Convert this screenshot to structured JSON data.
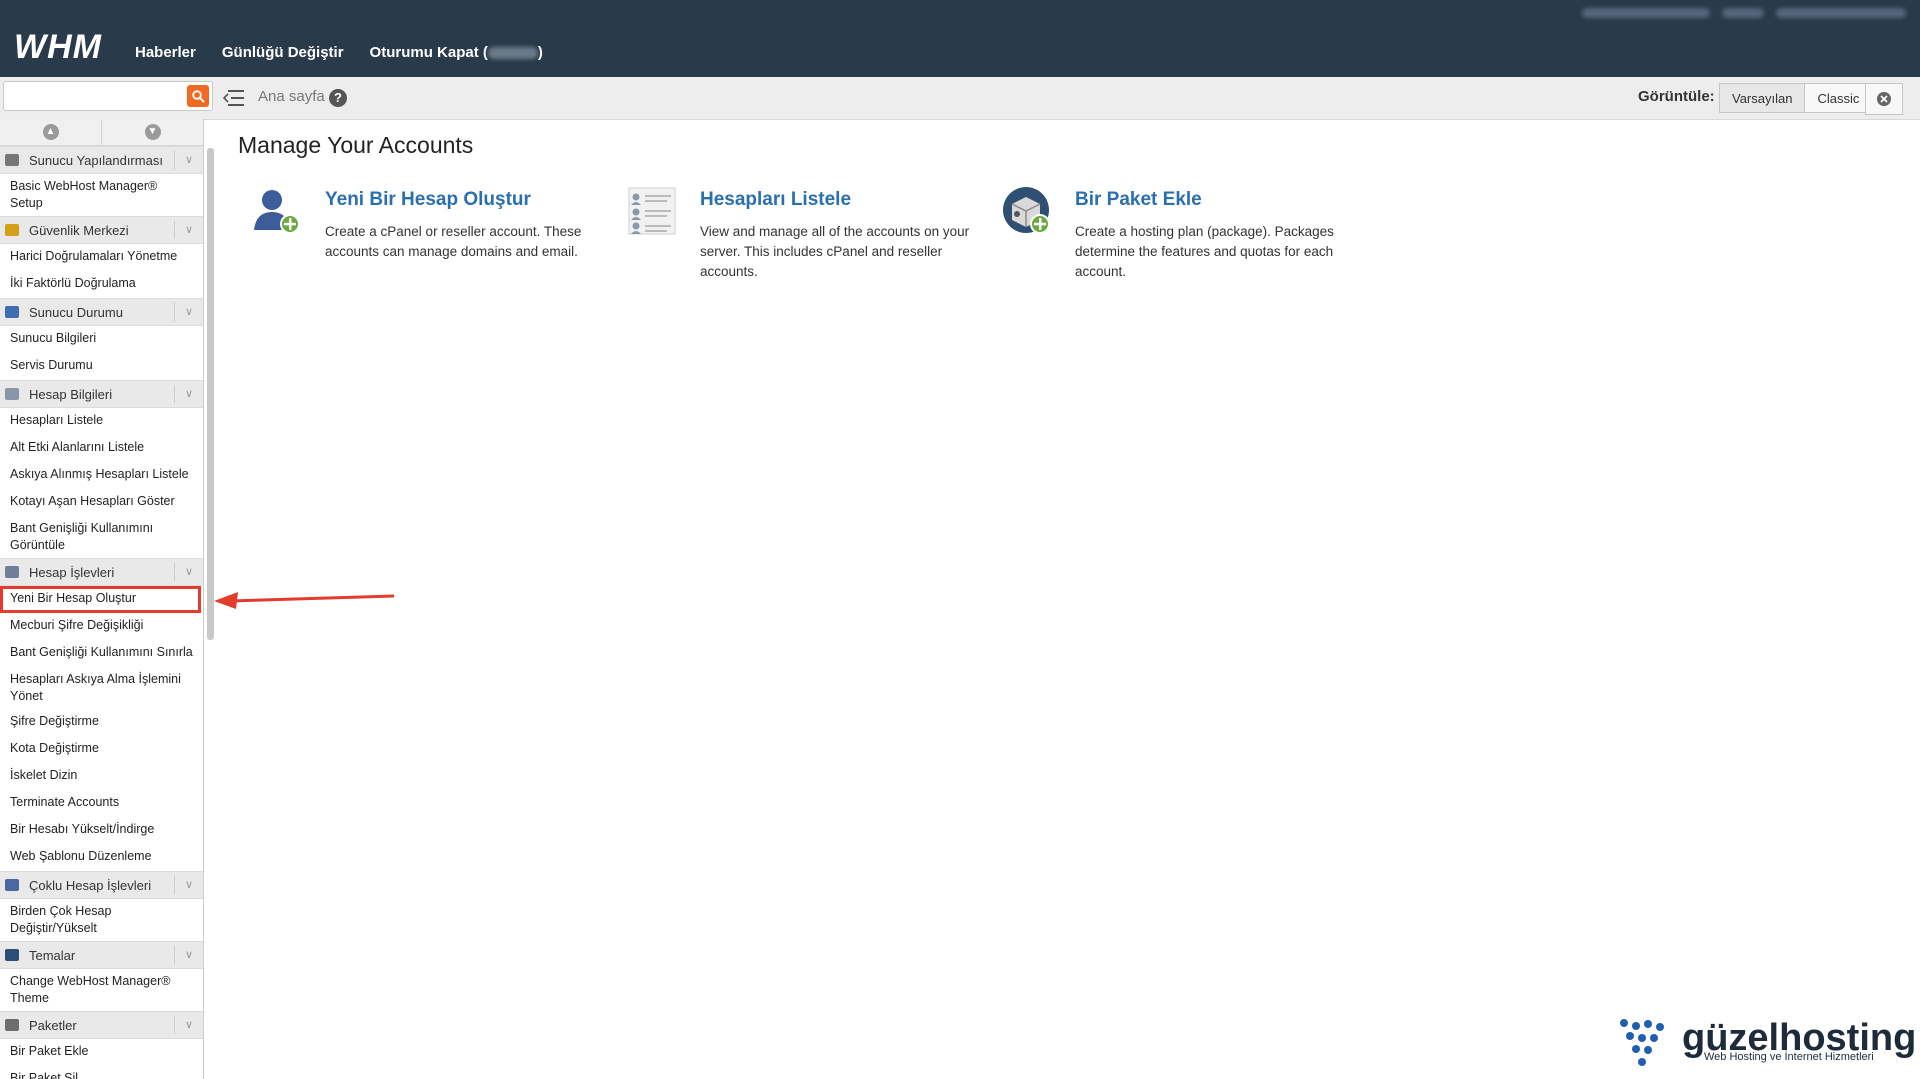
{
  "header": {
    "logo": "WHM",
    "nav": [
      "Haberler",
      "Günlüğü Değiştir",
      "Oturumu Kapat ("
    ],
    "nav_suffix": ")"
  },
  "toolbar": {
    "breadcrumb": "Ana sayfa",
    "help": "?",
    "view_label": "Görüntüle:",
    "view_default": "Varsayılan",
    "view_classic": "Classic"
  },
  "search": {
    "placeholder": ""
  },
  "sidebar": {
    "sections": [
      {
        "title": "Sunucu Yapılandırması",
        "icon": "server-config-icon",
        "items": [
          "Basic WebHost Manager® Setup"
        ]
      },
      {
        "title": "Güvenlik Merkezi",
        "icon": "lock-icon",
        "items": [
          "Harici Doğrulamaları Yönetme",
          "İki Faktörlü Doğrulama"
        ]
      },
      {
        "title": "Sunucu Durumu",
        "icon": "monitor-icon",
        "items": [
          "Sunucu Bilgileri",
          "Servis Durumu"
        ]
      },
      {
        "title": "Hesap Bilgileri",
        "icon": "account-info-icon",
        "items": [
          "Hesapları Listele",
          "Alt Etki Alanlarını Listele",
          "Askıya Alınmış Hesapları Listele",
          "Kotayı Aşan Hesapları Göster",
          "Bant Genişliği Kullanımını Görüntüle"
        ]
      },
      {
        "title": "Hesap İşlevleri",
        "icon": "user-functions-icon",
        "items": [
          "Yeni Bir Hesap Oluştur",
          "Mecburi Şifre Değişikliği",
          "Bant Genişliği Kullanımını Sınırla",
          "Hesapları Askıya Alma İşlemini Yönet",
          "Şifre Değiştirme",
          "Kota Değiştirme",
          "İskelet Dizin",
          "Terminate Accounts",
          "Bir Hesabı Yükselt/İndirge",
          "Web Şablonu Düzenleme"
        ]
      },
      {
        "title": "Çoklu Hesap İşlevleri",
        "icon": "multi-user-icon",
        "items": [
          "Birden Çok Hesap Değiştir/Yükselt"
        ]
      },
      {
        "title": "Temalar",
        "icon": "globe-icon",
        "items": [
          "Change WebHost Manager® Theme"
        ]
      },
      {
        "title": "Paketler",
        "icon": "package-icon",
        "items": [
          "Bir Paket Ekle",
          "Bir Paket Sil"
        ]
      }
    ],
    "selected_item": "Yeni Bir Hesap Oluştur"
  },
  "main": {
    "title": "Manage Your Accounts",
    "cards": [
      {
        "title": "Yeni Bir Hesap Oluştur",
        "description": "Create a cPanel or reseller account. These accounts can manage domains and email.",
        "icon": "add-user-icon"
      },
      {
        "title": "Hesapları Listele",
        "description": "View and manage all of the accounts on your server. This includes cPanel and reseller accounts.",
        "icon": "list-accounts-icon"
      },
      {
        "title": "Bir Paket Ekle",
        "description": "Create a hosting plan (package). Packages determine the features and quotas for each account.",
        "icon": "add-package-icon"
      }
    ]
  },
  "watermark": {
    "name": "güzelhosting",
    "tagline": "Web Hosting ve İnternet Hizmetleri"
  },
  "colors": {
    "header_bg": "#293a4a",
    "accent": "#f26a21",
    "link": "#2a6fb0",
    "highlight": "#e53b2c"
  }
}
